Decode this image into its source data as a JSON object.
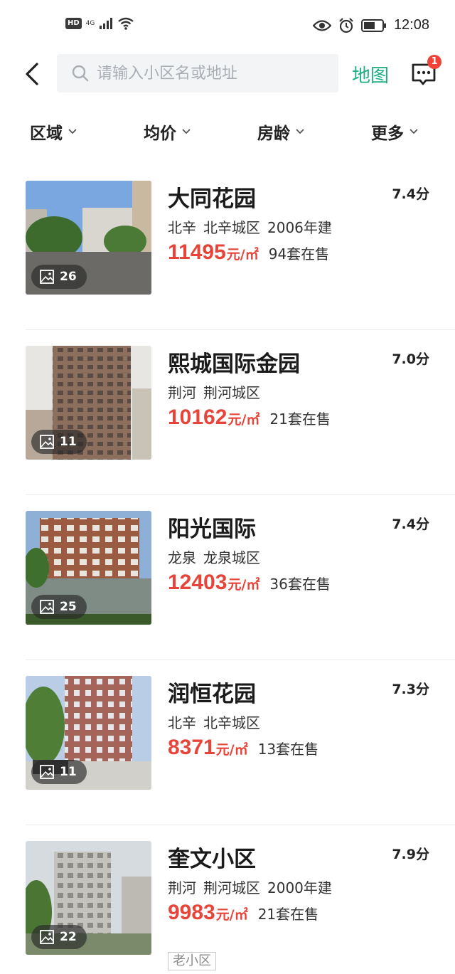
{
  "status_bar": {
    "hd": "HD",
    "network": "4G",
    "time": "12:08"
  },
  "search": {
    "placeholder": "请输入小区名或地址",
    "map_label": "地图",
    "message_badge": "1"
  },
  "filters": [
    {
      "label": "区域"
    },
    {
      "label": "均价"
    },
    {
      "label": "房龄"
    },
    {
      "label": "更多"
    }
  ],
  "listings": [
    {
      "name": "大同花园",
      "score": "7.4分",
      "area": "北辛",
      "district": "北辛城区",
      "year": "2006年建",
      "price": "11495",
      "unit": "元/㎡",
      "on_sale": "94套在售",
      "photos": "26",
      "tag": ""
    },
    {
      "name": "熙城国际金园",
      "score": "7.0分",
      "area": "荆河",
      "district": "荆河城区",
      "year": "",
      "price": "10162",
      "unit": "元/㎡",
      "on_sale": "21套在售",
      "photos": "11",
      "tag": ""
    },
    {
      "name": "阳光国际",
      "score": "7.4分",
      "area": "龙泉",
      "district": "龙泉城区",
      "year": "",
      "price": "12403",
      "unit": "元/㎡",
      "on_sale": "36套在售",
      "photos": "25",
      "tag": ""
    },
    {
      "name": "润恒花园",
      "score": "7.3分",
      "area": "北辛",
      "district": "北辛城区",
      "year": "",
      "price": "8371",
      "unit": "元/㎡",
      "on_sale": "13套在售",
      "photos": "11",
      "tag": ""
    },
    {
      "name": "奎文小区",
      "score": "7.9分",
      "area": "荆河",
      "district": "荆河城区",
      "year": "2000年建",
      "price": "9983",
      "unit": "元/㎡",
      "on_sale": "21套在售",
      "photos": "22",
      "tag": "老小区"
    }
  ],
  "colors": {
    "accent_green": "#1fae80",
    "price_red": "#e8443a",
    "badge_red": "#f04236"
  }
}
